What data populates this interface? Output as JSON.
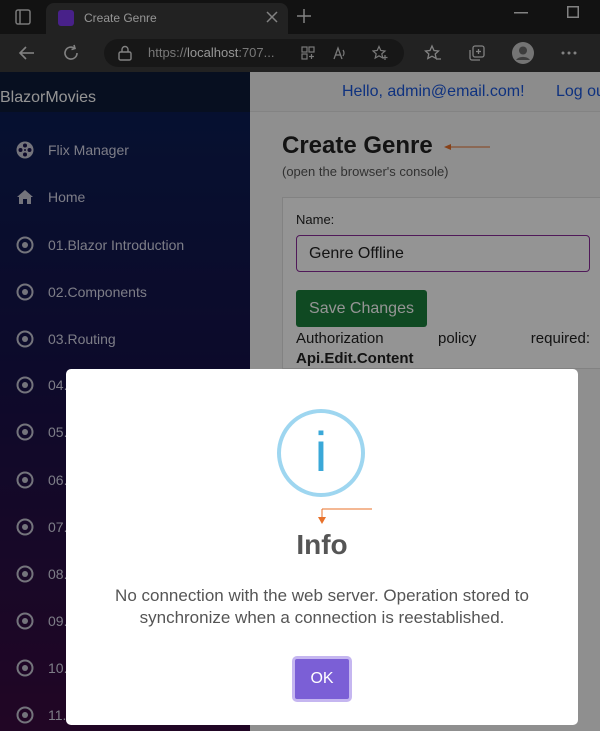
{
  "browser": {
    "tab_title": "Create Genre",
    "url_prefix": "https://",
    "url_host": "localhost",
    "url_suffix": ":707..."
  },
  "sidebar": {
    "brand": "BlazorMovies",
    "items": [
      {
        "label": "Flix Manager",
        "icon": "film-reel-icon"
      },
      {
        "label": "Home",
        "icon": "home-icon"
      },
      {
        "label": "01.Blazor Introduction",
        "icon": "target-icon"
      },
      {
        "label": "02.Components",
        "icon": "target-icon"
      },
      {
        "label": "03.Routing",
        "icon": "target-icon"
      },
      {
        "label": "04.",
        "icon": "target-icon"
      },
      {
        "label": "05.",
        "icon": "target-icon"
      },
      {
        "label": "06.",
        "icon": "target-icon"
      },
      {
        "label": "07.",
        "icon": "target-icon"
      },
      {
        "label": "08.",
        "icon": "target-icon"
      },
      {
        "label": "09.",
        "icon": "target-icon"
      },
      {
        "label": "10.",
        "icon": "target-icon"
      },
      {
        "label": "11.",
        "icon": "target-icon"
      }
    ]
  },
  "header": {
    "greeting": "Hello, admin@email.com!",
    "logout": "Log ou"
  },
  "page": {
    "title": "Create Genre",
    "subtitle": "(open the browser's console)",
    "form": {
      "name_label": "Name:",
      "name_value": "Genre Offline",
      "save_label": "Save Changes",
      "auth_words": [
        "Authorization",
        "policy",
        "required:"
      ],
      "auth_policy": "Api.Edit.Content"
    }
  },
  "modal": {
    "icon_glyph": "i",
    "title": "Info",
    "message": "No connection with the web server. Operation stored to synchronize when a connection is reestablished.",
    "ok_label": "OK"
  },
  "colors": {
    "accent_green": "#1a7f3b",
    "ok_purple": "#7b5fd6",
    "link_blue": "#1a56db",
    "annotation_orange": "#e8712a"
  }
}
